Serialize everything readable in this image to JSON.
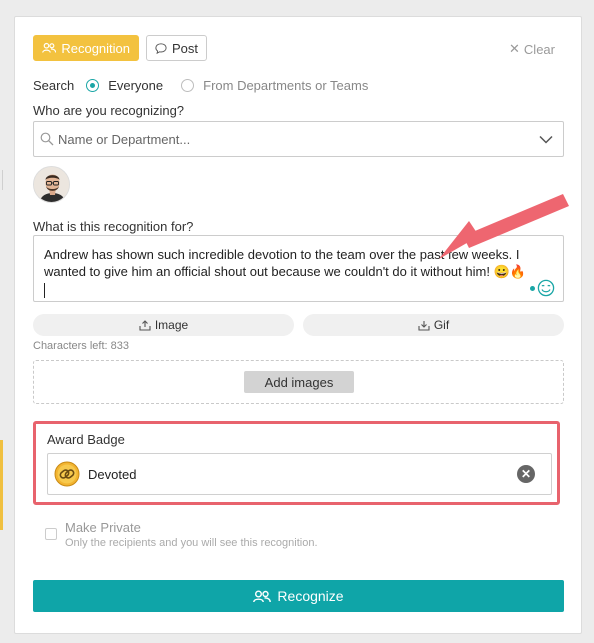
{
  "tabs": {
    "recognition_label": "Recognition",
    "post_label": "Post"
  },
  "clear_label": "Clear",
  "search": {
    "label": "Search",
    "options": [
      "Everyone",
      "From Departments or Teams"
    ],
    "selected": "Everyone"
  },
  "recipient": {
    "label": "Who are you recognizing?",
    "placeholder": "Name or Department..."
  },
  "reason": {
    "label": "What is this recognition for?",
    "line1": "Andrew has shown such incredible devotion to the team over the past few weeks. I",
    "line2": "wanted to give him an official shout out because we couldn't do it without him! 😀🔥"
  },
  "attachments": {
    "image_label": "Image",
    "gif_label": "Gif",
    "characters_left": "Characters left: 833",
    "add_images_label": "Add images"
  },
  "award": {
    "label": "Award Badge",
    "badge_name": "Devoted"
  },
  "private": {
    "title": "Make Private",
    "description": "Only the recipients and you will see this recognition."
  },
  "submit_label": "Recognize",
  "colors": {
    "recognition_tab": "#f3c23f",
    "primary_button": "#0fa5a8",
    "highlight_frame": "#e8636d",
    "radio_selected": "#1aa6a6"
  }
}
